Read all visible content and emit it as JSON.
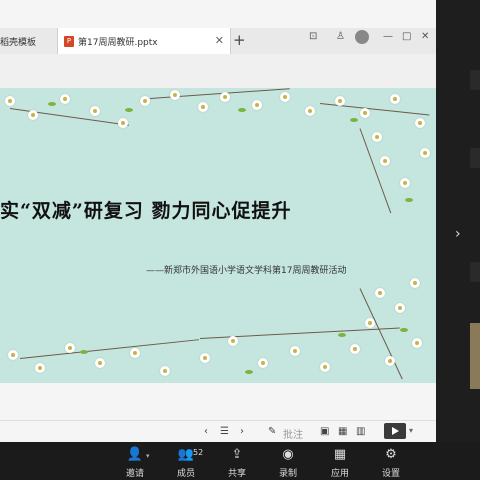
{
  "tabs": [
    {
      "label": "稻壳模板"
    },
    {
      "label": "第17周周教研.pptx"
    }
  ],
  "slide": {
    "title": "实“双减”研复习    勠力同心促提升",
    "subtitle": "——新郑市外国语小学语文学科第17周周教研活动"
  },
  "bottom_bar": {
    "note_label": "批注"
  },
  "dock": {
    "items": [
      {
        "label": "邀请",
        "icon": "invite-icon"
      },
      {
        "label": "成员",
        "icon": "members-icon",
        "count": "52"
      },
      {
        "label": "共享",
        "icon": "share-icon"
      },
      {
        "label": "录制",
        "icon": "record-icon"
      },
      {
        "label": "应用",
        "icon": "apps-icon"
      },
      {
        "label": "设置",
        "icon": "settings-icon"
      }
    ]
  },
  "colors": {
    "slide_bg": "#c5e6de",
    "ppt_icon": "#d24726",
    "dock_bg": "#1b1b1b"
  }
}
